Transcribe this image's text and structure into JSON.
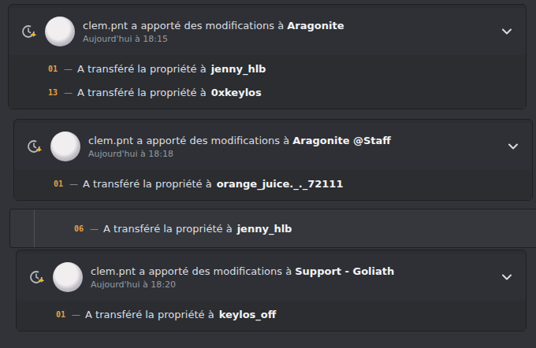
{
  "entries": [
    {
      "kind": "entry",
      "user": "clem.pnt",
      "action": "a apporté des modifications à",
      "target": "Aragonite",
      "time": "Aujourd'hui à 18:15",
      "changes": [
        {
          "num": "01",
          "separator": "—",
          "text": "A transféré la propriété à",
          "value": "jenny_hlb"
        },
        {
          "num": "13",
          "separator": "—",
          "text": "A transféré la propriété à",
          "value": "0xkeylos"
        }
      ]
    },
    {
      "kind": "entry",
      "user": "clem.pnt",
      "action": "a apporté des modifications à",
      "target": "Aragonite @Staff",
      "time": "Aujourd'hui à 18:18",
      "changes": [
        {
          "num": "01",
          "separator": "—",
          "text": "A transféré la propriété à",
          "value": "orange_juice._._72111"
        }
      ]
    },
    {
      "kind": "continuation",
      "changes": [
        {
          "num": "06",
          "separator": "—",
          "text": "A transféré la propriété à",
          "value": "jenny_hlb"
        }
      ]
    },
    {
      "kind": "entry",
      "user": "clem.pnt",
      "action": "a apporté des modifications à",
      "target": "Support - Goliath",
      "time": "Aujourd'hui à 18:20",
      "changes": [
        {
          "num": "01",
          "separator": "—",
          "text": "A transféré la propriété à",
          "value": "keylos_off"
        }
      ]
    }
  ]
}
